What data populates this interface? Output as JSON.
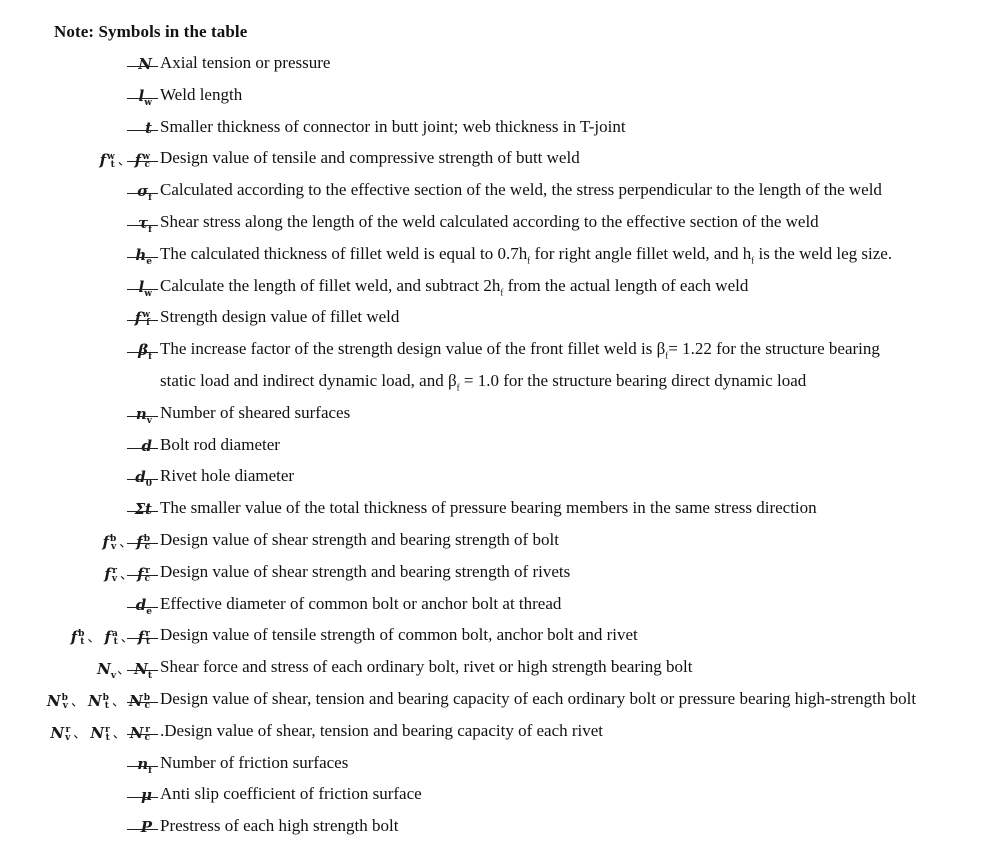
{
  "heading": "Note: Symbols in the table",
  "entries": [
    {
      "symbol": "N",
      "desc": "Axial tension or pressure"
    },
    {
      "symbol": "l_w",
      "desc": "Weld length"
    },
    {
      "symbol": "t",
      "desc": "Smaller thickness of connector in butt joint; web thickness in T-joint"
    },
    {
      "symbol": "f_t^w、f_c^w",
      "desc": "Design value of tensile and compressive strength of butt weld"
    },
    {
      "symbol": "σ_f",
      "desc": "Calculated according to the effective section of the weld, the stress perpendicular to the length of the weld"
    },
    {
      "symbol": "τ_f",
      "desc": "Shear stress along the length of the weld calculated according to the effective section of the weld"
    },
    {
      "symbol": "h_e",
      "desc_a": "The calculated thickness of fillet weld is equal to 0.7h",
      "desc_b": " for right angle fillet weld, and h",
      "desc_c": " is the weld leg size.",
      "sub": "f"
    },
    {
      "symbol": "l_w",
      "desc_a": "Calculate the length of fillet weld, and subtract 2h",
      "desc_b": " from the actual length of each weld",
      "sub": "f"
    },
    {
      "symbol": "f_f^w",
      "desc": "Strength design value of fillet weld"
    },
    {
      "symbol": "β_f",
      "desc_a": "The increase factor of the strength design value of the front fillet weld is β",
      "desc_b": "= 1.22 for the structure bearing",
      "cont_a": "static load and indirect dynamic load, and β",
      "cont_b": " = 1.0 for the structure bearing direct dynamic load",
      "sub": "f"
    },
    {
      "symbol": "n_v",
      "desc": "Number of sheared surfaces"
    },
    {
      "symbol": "d",
      "desc": "Bolt rod diameter"
    },
    {
      "symbol": "d_0",
      "desc": "Rivet hole diameter"
    },
    {
      "symbol": "Σt",
      "desc": "The smaller value of the total thickness of pressure bearing members in the same stress direction"
    },
    {
      "symbol": "f_v^b、f_c^b",
      "desc": "Design value of shear strength and bearing strength of bolt"
    },
    {
      "symbol": "f_v^r、f_c^r",
      "desc": "Design value of shear strength and bearing strength of rivets"
    },
    {
      "symbol": "d_e",
      "desc": "Effective diameter of common bolt or anchor bolt at thread"
    },
    {
      "symbol": "f_t^b、f_t^a、f_t^r",
      "desc": "Design value of tensile strength of common bolt, anchor bolt and rivet"
    },
    {
      "symbol": "N_v、N_t",
      "desc": "Shear force and stress of each ordinary bolt, rivet or high strength bearing bolt"
    },
    {
      "symbol": "N_v^b、N_t^b、N_c^b",
      "desc": "Design value of shear, tension and bearing capacity of each ordinary bolt or pressure bearing high-strength bolt"
    },
    {
      "symbol": "N_v^r、N_t^r、N_c^r",
      "desc": ".Design value of shear, tension and bearing capacity of each rivet"
    },
    {
      "symbol": "n_f",
      "desc": "Number of friction surfaces"
    },
    {
      "symbol": "μ",
      "desc": "Anti slip coefficient of friction surface"
    },
    {
      "symbol": "P",
      "desc": "Prestress of each high strength bolt"
    }
  ]
}
